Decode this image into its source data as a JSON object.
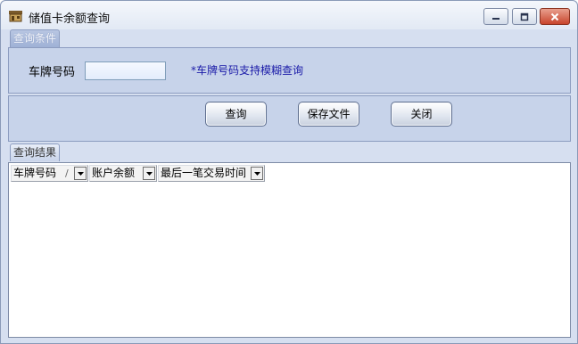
{
  "window": {
    "title": "储值卡余额查询"
  },
  "query_group": {
    "tab_label": "查询条件",
    "plate_label": "车牌号码",
    "plate_value": "",
    "hint": "*车牌号码支持模糊查询"
  },
  "buttons": {
    "query": "查询",
    "save": "保存文件",
    "close": "关闭"
  },
  "result_group": {
    "tab_label": "查询结果",
    "columns": [
      {
        "label": "车牌号码",
        "sort": "/"
      },
      {
        "label": "账户余额"
      },
      {
        "label": "最后一笔交易时间"
      }
    ]
  }
}
